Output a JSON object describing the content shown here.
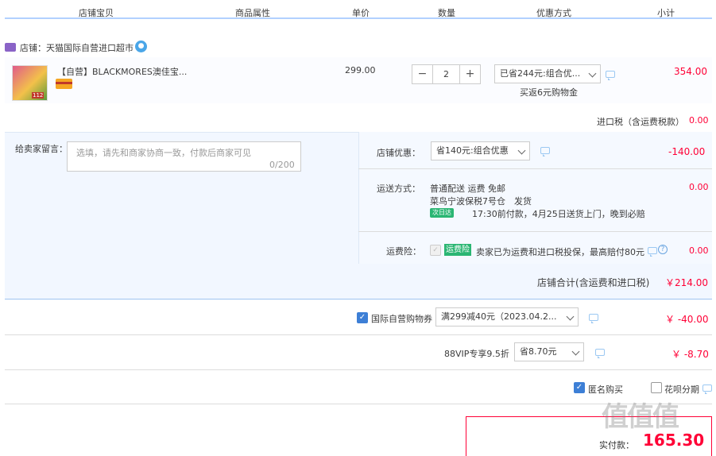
{
  "columns": [
    "店铺宝贝",
    "商品属性",
    "单价",
    "数量",
    "优惠方式",
    "小计"
  ],
  "shop": {
    "label": "店铺：天猫国际自营进口超市"
  },
  "item": {
    "title": "【自营】BLACKMORES澳佳宝...",
    "thumb_badge": "112",
    "unit_price": "299.00",
    "quantity": "2",
    "minus": "−",
    "plus": "+",
    "discount_select": "已省244元:组合优...",
    "discount_note": "买返6元购物金",
    "subtotal": "354.00"
  },
  "import_tax": {
    "label": "进口税（含运费税款）",
    "value": "0.00"
  },
  "message": {
    "label": "给卖家留言：",
    "placeholder": "选填，请先和商家协商一致，付款后商家可见",
    "counter": "0/200"
  },
  "shop_discount": {
    "label": "店铺优惠：",
    "select": "省140元:组合优惠",
    "value": "-140.00"
  },
  "shipping": {
    "label": "运送方式：",
    "line1": "普通配送 运费 免邮",
    "line2": "菜鸟宁波保税7号仓　发货",
    "badge": "次日达",
    "line3": "17:30前付款，4月25日送货上门，晚到必赔",
    "value": "0.00"
  },
  "insurance": {
    "label": "运费险：",
    "badge": "运费险",
    "text": "卖家已为运费和进口税投保，最高赔付80元",
    "value": "0.00"
  },
  "shop_total": {
    "label": "店铺合计(含运费和进口税)",
    "value": "￥214.00"
  },
  "coupon": {
    "label": "国际自营购物券",
    "select": "满299减40元（2023.04.2...",
    "value": "￥ -40.00"
  },
  "vip": {
    "label": "88VIP专享9.5折",
    "select": "省8.70元",
    "value": "￥ -8.70"
  },
  "options": {
    "anonymous": "匿名购买",
    "huabei": "花呗分期"
  },
  "pay": {
    "label": "实付款：",
    "value": "165.30"
  },
  "watermark": "值值值",
  "colors": {
    "accent": "#ff0036",
    "blue_line": "#b2d1ff",
    "panel_bg": "#f2f7ff",
    "row_bg": "#fbfcff"
  }
}
